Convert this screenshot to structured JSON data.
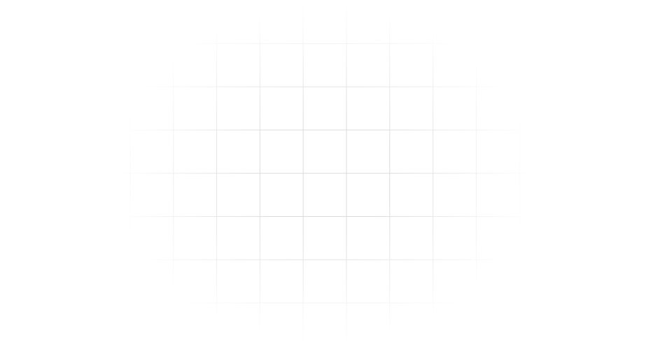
{
  "background": {
    "color": "#ffffff",
    "grid_line_color": "#dcdcdc",
    "pattern": "grid-fade"
  }
}
